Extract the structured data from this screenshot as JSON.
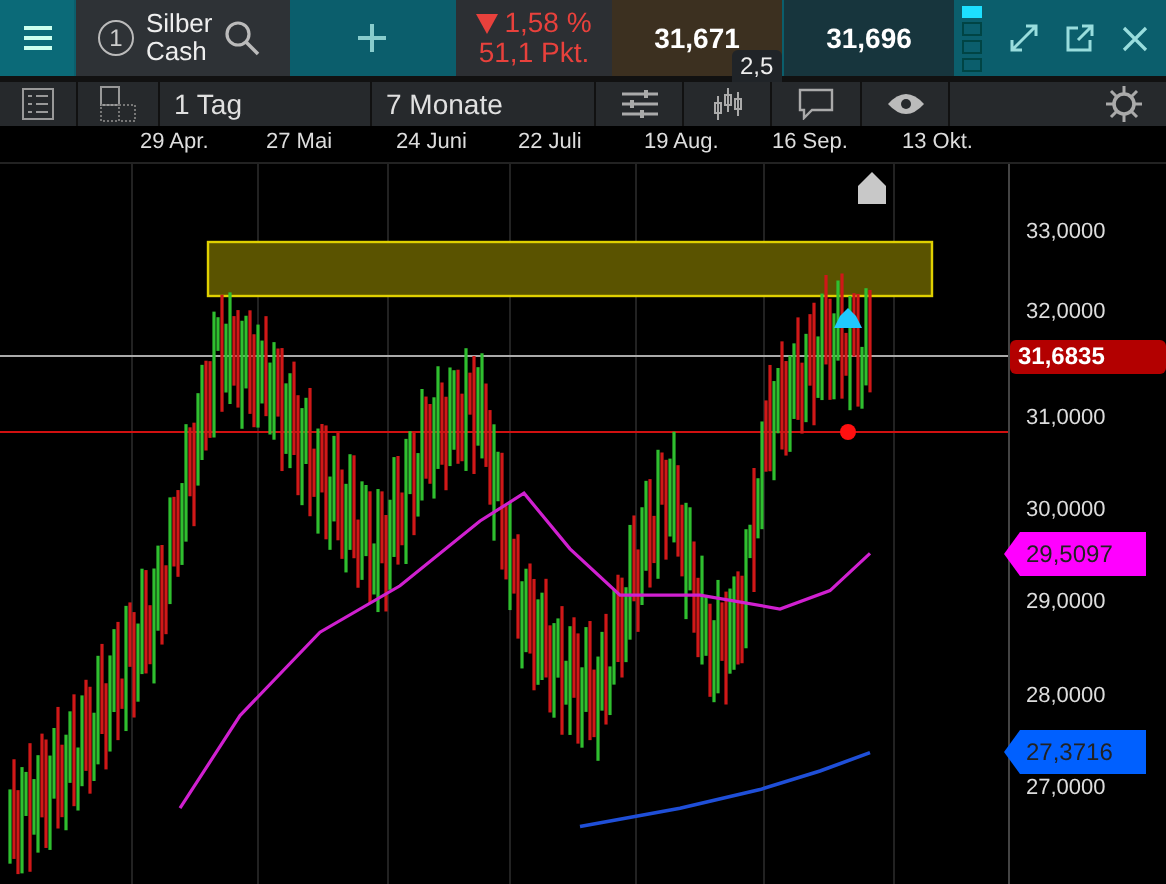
{
  "instrument": {
    "number": "1",
    "name_line1": "Silber",
    "name_line2": "Cash"
  },
  "change": {
    "falling": true,
    "percent": "1,58 %",
    "points": "51,1 Pkt."
  },
  "bid": "31,671",
  "ask": "31,696",
  "spread": "2,5",
  "toolbar": {
    "interval": "1 Tag",
    "range": "7 Monate"
  },
  "date_labels": [
    "29 Apr.",
    "27 Mai",
    "24 Juni",
    "22 Juli",
    "19 Aug.",
    "16 Sep.",
    "13 Okt."
  ],
  "price_labels": [
    "33,0000",
    "32,0000",
    "31,0000",
    "30,0000",
    "29,0000",
    "28,0000",
    "27,0000"
  ],
  "price_tags": [
    {
      "label": "31,6835",
      "color": "#b30000",
      "kind": "box"
    },
    {
      "label": "29,5097",
      "color": "#ff00ff",
      "kind": "arrow"
    },
    {
      "label": "27,3716",
      "color": "#0060ff",
      "kind": "arrow"
    }
  ]
}
